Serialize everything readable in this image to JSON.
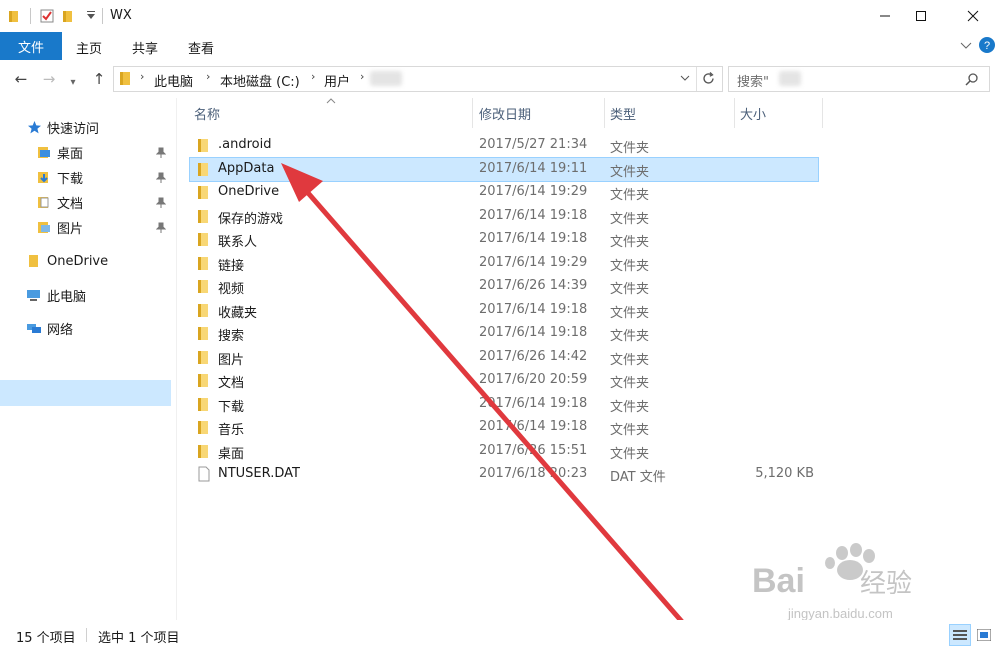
{
  "window": {
    "title": "WX"
  },
  "ribbon": {
    "tabs": [
      "文件",
      "主页",
      "共享",
      "查看"
    ]
  },
  "address": {
    "crumbs": [
      "此电脑",
      "本地磁盘 (C:)",
      "用户"
    ],
    "search_placeholder": "搜索\""
  },
  "nav": {
    "quick_access": "快速访问",
    "pinned": [
      "桌面",
      "下载",
      "文档",
      "图片"
    ],
    "onedrive": "OneDrive",
    "this_pc": "此电脑",
    "network": "网络"
  },
  "columns": {
    "name": "名称",
    "date": "修改日期",
    "type": "类型",
    "size": "大小"
  },
  "files": [
    {
      "name": ".android",
      "date": "2017/5/27 21:34",
      "type": "文件夹",
      "size": "",
      "icon": "folder-icon"
    },
    {
      "name": "AppData",
      "date": "2017/6/14 19:11",
      "type": "文件夹",
      "size": "",
      "icon": "folder-hidden-icon",
      "selected": true
    },
    {
      "name": "OneDrive",
      "date": "2017/6/14 19:29",
      "type": "文件夹",
      "size": "",
      "icon": "onedrive-folder-icon"
    },
    {
      "name": "保存的游戏",
      "date": "2017/6/14 19:18",
      "type": "文件夹",
      "size": "",
      "icon": "saved-games-icon"
    },
    {
      "name": "联系人",
      "date": "2017/6/14 19:18",
      "type": "文件夹",
      "size": "",
      "icon": "contacts-icon"
    },
    {
      "name": "链接",
      "date": "2017/6/14 19:29",
      "type": "文件夹",
      "size": "",
      "icon": "links-icon"
    },
    {
      "name": "视频",
      "date": "2017/6/26 14:39",
      "type": "文件夹",
      "size": "",
      "icon": "videos-icon"
    },
    {
      "name": "收藏夹",
      "date": "2017/6/14 19:18",
      "type": "文件夹",
      "size": "",
      "icon": "favorites-icon"
    },
    {
      "name": "搜索",
      "date": "2017/6/14 19:18",
      "type": "文件夹",
      "size": "",
      "icon": "searches-icon"
    },
    {
      "name": "图片",
      "date": "2017/6/26 14:42",
      "type": "文件夹",
      "size": "",
      "icon": "pictures-icon"
    },
    {
      "name": "文档",
      "date": "2017/6/20 20:59",
      "type": "文件夹",
      "size": "",
      "icon": "documents-icon"
    },
    {
      "name": "下载",
      "date": "2017/6/14 19:18",
      "type": "文件夹",
      "size": "",
      "icon": "downloads-icon"
    },
    {
      "name": "音乐",
      "date": "2017/6/14 19:18",
      "type": "文件夹",
      "size": "",
      "icon": "music-icon"
    },
    {
      "name": "桌面",
      "date": "2017/6/26 15:51",
      "type": "文件夹",
      "size": "",
      "icon": "desktop-icon"
    },
    {
      "name": "NTUSER.DAT",
      "date": "2017/6/18 20:23",
      "type": "DAT 文件",
      "size": "5,120 KB",
      "icon": "file-icon"
    }
  ],
  "status": {
    "count": "15 个项目",
    "selection": "选中 1 个项目"
  },
  "watermark": {
    "brand": "Bai",
    "brand_suffix": "经验",
    "url": "jingyan.baidu.com"
  },
  "colors": {
    "accent": "#1979ca",
    "selection": "#cce8ff",
    "arrow": "#e0393e",
    "folder": "#f8d775"
  }
}
